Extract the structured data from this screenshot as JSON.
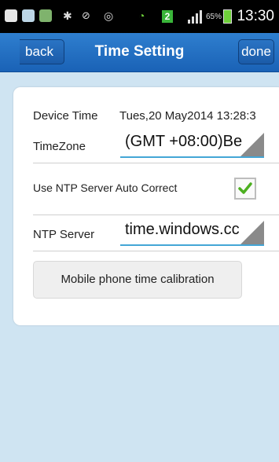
{
  "status_bar": {
    "time": "13:30",
    "battery_percent": "65%",
    "network_badge": "2",
    "icons": [
      "add-icon",
      "messenger-icon",
      "app-icon",
      "bluetooth-icon",
      "mute-icon",
      "alarm-icon",
      "wifi-icon",
      "signal-icon",
      "battery-icon"
    ]
  },
  "nav": {
    "back_label": "back",
    "title": "Time Setting",
    "done_label": "done"
  },
  "form": {
    "device_time_label": "Device Time",
    "device_time_value": "Tues,20 May2014 13:28:3",
    "timezone_label": "TimeZone",
    "timezone_value": "(GMT +08:00)Be",
    "ntp_auto_label": "Use NTP Server Auto Correct",
    "ntp_auto_checked": true,
    "ntp_server_label": "NTP Server",
    "ntp_server_value": "time.windows.cc",
    "calibrate_label": "Mobile phone time calibration"
  },
  "colors": {
    "nav_bar": "#1f6bbd",
    "page_background": "#cfe4f2",
    "check": "#4caf1f",
    "input_underline": "#44a6d6"
  }
}
